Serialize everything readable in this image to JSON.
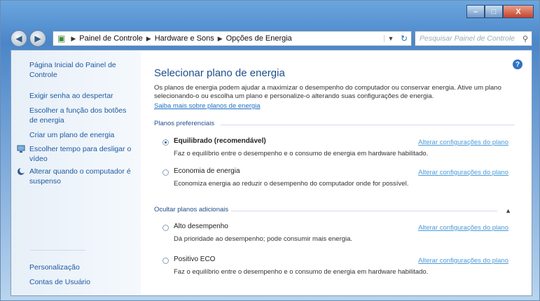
{
  "window": {
    "controls": [
      "–",
      "□",
      "X"
    ]
  },
  "address": {
    "crumbs": [
      "Painel de Controle",
      "Hardware e Sons",
      "Opções de Energia"
    ],
    "search_placeholder": "Pesquisar Painel de Controle"
  },
  "sidebar": {
    "home": "Página Inicial do Painel de Controle",
    "items": [
      {
        "label": "Exigir senha ao despertar",
        "icon": ""
      },
      {
        "label": "Escolher a função dos botões de energia",
        "icon": ""
      },
      {
        "label": "Criar um plano de energia",
        "icon": ""
      },
      {
        "label": "Escolher tempo para desligar o vídeo",
        "icon": "monitor-icon"
      },
      {
        "label": "Alterar quando o computador é suspenso",
        "icon": "moon-icon"
      }
    ],
    "see_also": [
      "Personalização",
      "Contas de Usuário"
    ]
  },
  "main": {
    "title": "Selecionar plano de energia",
    "description": "Os planos de energia podem ajudar a maximizar o desempenho do computador ou conservar energia. Ative um plano selecionando-o ou escolha um plano e personalize-o alterando suas configurações de energia.",
    "learn_more": "Saiba mais sobre planos de energia",
    "preferred_label": "Planos preferenciais",
    "hidden_label": "Ocultar planos adicionais",
    "change_link": "Alterar configurações do plano",
    "preferred_plans": [
      {
        "name": "Equilibrado (recomendável)",
        "desc": "Faz o equilíbrio entre o desempenho e o consumo de energia em hardware habilitado.",
        "selected": true
      },
      {
        "name": "Economia de energia",
        "desc": "Economiza energia ao reduzir o desempenho do computador onde for possível.",
        "selected": false
      }
    ],
    "additional_plans": [
      {
        "name": "Alto desempenho",
        "desc": "Dá prioridade ao desempenho; pode consumir mais energia.",
        "selected": false
      },
      {
        "name": "Positivo ECO",
        "desc": "Faz o equilíbrio entre o desempenho e o consumo de energia em hardware habilitado.",
        "selected": false
      }
    ]
  }
}
